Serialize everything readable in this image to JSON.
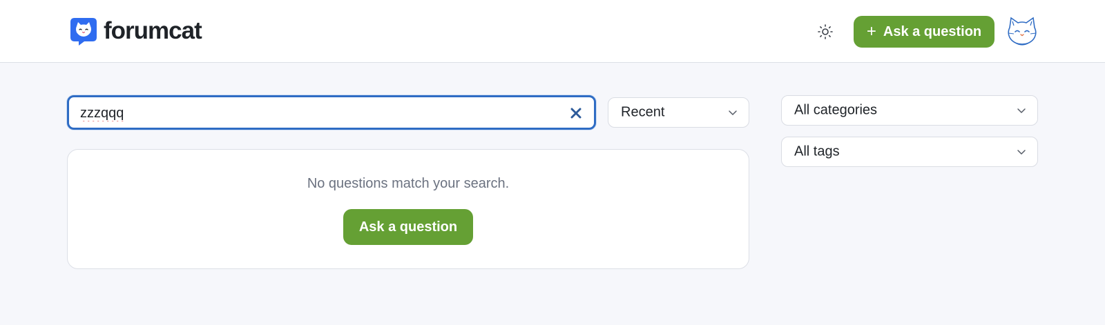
{
  "header": {
    "brand": "forumcat",
    "ask_button_label": "Ask a question",
    "ask_button_plus": "+"
  },
  "search": {
    "value": "zzzqqq"
  },
  "sort": {
    "selected": "Recent"
  },
  "filters": {
    "category_selected": "All categories",
    "tag_selected": "All tags"
  },
  "results": {
    "empty_message": "No questions match your search.",
    "ask_button_label": "Ask a question"
  },
  "colors": {
    "accent_green": "#65a034",
    "brand_blue": "#2f6cc4",
    "focus_border": "#2f6cc4",
    "background": "#f6f7fb"
  },
  "icons": {
    "logo": "cat-chat-bubble-icon",
    "theme": "sun-icon",
    "clear": "close-icon",
    "dropdown": "chevron-down-icon",
    "avatar": "cat-avatar"
  }
}
